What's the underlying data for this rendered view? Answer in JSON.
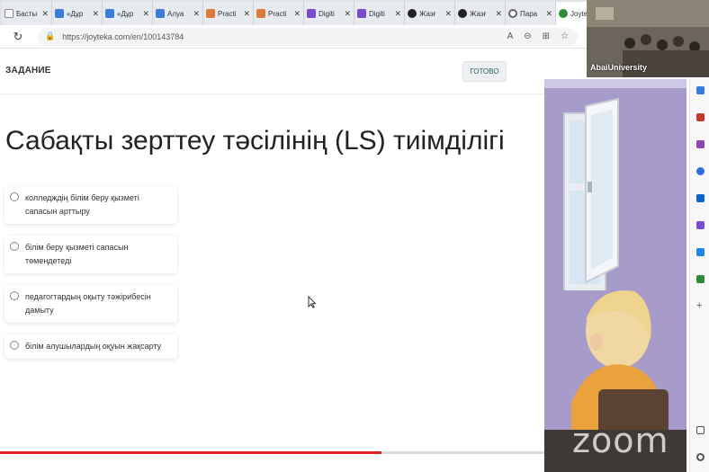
{
  "tabs": [
    {
      "label": "Басты",
      "icon": "document-icon",
      "color": "#ffffff"
    },
    {
      "label": "«Дұр",
      "icon": "app-icon",
      "color": "#3b7ddd"
    },
    {
      "label": "«Дұр",
      "icon": "app-icon",
      "color": "#3b7ddd"
    },
    {
      "label": "Алуа",
      "icon": "app-icon",
      "color": "#3b7ddd"
    },
    {
      "label": "Practi",
      "icon": "puzzle-icon",
      "color": "#e07a3c"
    },
    {
      "label": "Practi",
      "icon": "puzzle-icon",
      "color": "#e07a3c"
    },
    {
      "label": "Digiti",
      "icon": "grid-icon",
      "color": "#7a4bd1"
    },
    {
      "label": "Digiti",
      "icon": "grid-icon",
      "color": "#7a4bd1"
    },
    {
      "label": "Жазғ",
      "icon": "face-icon",
      "color": "#222222"
    },
    {
      "label": "Жазғ",
      "icon": "face-icon",
      "color": "#222222"
    },
    {
      "label": "Пара",
      "icon": "gear-icon",
      "color": "#666666"
    },
    {
      "label": "Joyte",
      "icon": "joyteka-icon",
      "color": "#2e8b3a"
    }
  ],
  "address": {
    "url": "https://joyteka.com/en/100143784"
  },
  "task": {
    "heading": "ЗАДАНИЕ",
    "ready_button": "ГОТОВО"
  },
  "question": "Сабақты зерттеу тәсілінің (LS) тиімділігі",
  "options": [
    "колледждің білім беру қызметі сапасын арттыру",
    "білім беру қызметі сапасын төмендетеді",
    "педагогтардың оқыту тәжірибесін дамыту",
    "білім алушылардың оқуын жақсарту"
  ],
  "video": {
    "label": "AbaiUniversity"
  },
  "watermark": "zoom",
  "video_progress": 0.7,
  "colors": {
    "accent": "#e31e24",
    "illustration_bg": "#a79bc9"
  }
}
